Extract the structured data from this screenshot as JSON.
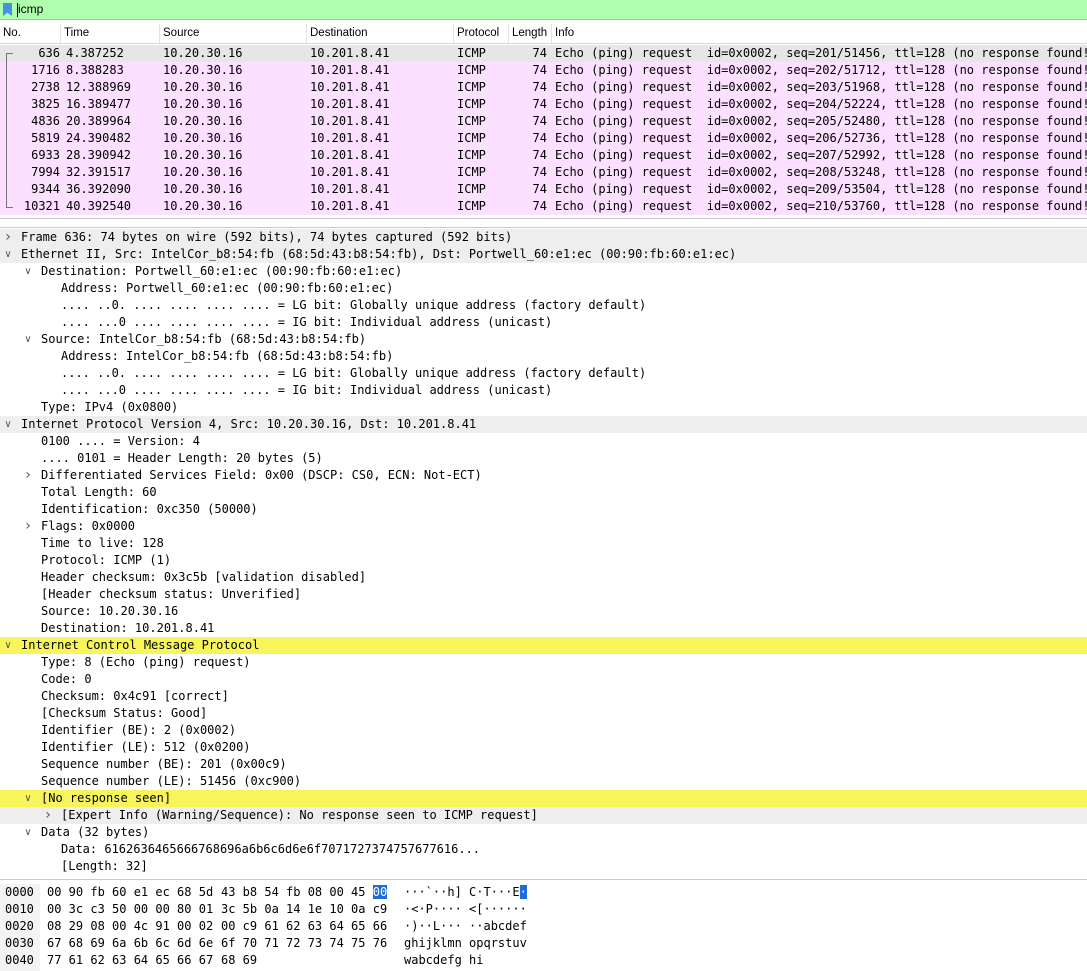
{
  "filter": {
    "value": "icmp"
  },
  "columns": [
    "No.",
    "Time",
    "Source",
    "Destination",
    "Protocol",
    "Length",
    "Info"
  ],
  "packets": [
    {
      "no": "636",
      "time": "4.387252",
      "src": "10.20.30.16",
      "dst": "10.201.8.41",
      "proto": "ICMP",
      "len": "74",
      "info": "Echo (ping) request  id=0x0002, seq=201/51456, ttl=128 (no response found!)"
    },
    {
      "no": "1716",
      "time": "8.388283",
      "src": "10.20.30.16",
      "dst": "10.201.8.41",
      "proto": "ICMP",
      "len": "74",
      "info": "Echo (ping) request  id=0x0002, seq=202/51712, ttl=128 (no response found!)"
    },
    {
      "no": "2738",
      "time": "12.388969",
      "src": "10.20.30.16",
      "dst": "10.201.8.41",
      "proto": "ICMP",
      "len": "74",
      "info": "Echo (ping) request  id=0x0002, seq=203/51968, ttl=128 (no response found!)"
    },
    {
      "no": "3825",
      "time": "16.389477",
      "src": "10.20.30.16",
      "dst": "10.201.8.41",
      "proto": "ICMP",
      "len": "74",
      "info": "Echo (ping) request  id=0x0002, seq=204/52224, ttl=128 (no response found!)"
    },
    {
      "no": "4836",
      "time": "20.389964",
      "src": "10.20.30.16",
      "dst": "10.201.8.41",
      "proto": "ICMP",
      "len": "74",
      "info": "Echo (ping) request  id=0x0002, seq=205/52480, ttl=128 (no response found!)"
    },
    {
      "no": "5819",
      "time": "24.390482",
      "src": "10.20.30.16",
      "dst": "10.201.8.41",
      "proto": "ICMP",
      "len": "74",
      "info": "Echo (ping) request  id=0x0002, seq=206/52736, ttl=128 (no response found!)"
    },
    {
      "no": "6933",
      "time": "28.390942",
      "src": "10.20.30.16",
      "dst": "10.201.8.41",
      "proto": "ICMP",
      "len": "74",
      "info": "Echo (ping) request  id=0x0002, seq=207/52992, ttl=128 (no response found!)"
    },
    {
      "no": "7994",
      "time": "32.391517",
      "src": "10.20.30.16",
      "dst": "10.201.8.41",
      "proto": "ICMP",
      "len": "74",
      "info": "Echo (ping) request  id=0x0002, seq=208/53248, ttl=128 (no response found!)"
    },
    {
      "no": "9344",
      "time": "36.392090",
      "src": "10.20.30.16",
      "dst": "10.201.8.41",
      "proto": "ICMP",
      "len": "74",
      "info": "Echo (ping) request  id=0x0002, seq=209/53504, ttl=128 (no response found!)"
    },
    {
      "no": "10321",
      "time": "40.392540",
      "src": "10.20.30.16",
      "dst": "10.201.8.41",
      "proto": "ICMP",
      "len": "74",
      "info": "Echo (ping) request  id=0x0002, seq=210/53760, ttl=128 (no response found!)"
    }
  ],
  "details": [
    {
      "level": 0,
      "exp": "collapsed",
      "text": "Frame 636: 74 bytes on wire (592 bits), 74 bytes captured (592 bits)",
      "style": "hl"
    },
    {
      "level": 0,
      "exp": "expanded",
      "text": "Ethernet II, Src: IntelCor_b8:54:fb (68:5d:43:b8:54:fb), Dst: Portwell_60:e1:ec (00:90:fb:60:e1:ec)",
      "style": "hl"
    },
    {
      "level": 1,
      "exp": "expanded",
      "text": "Destination: Portwell_60:e1:ec (00:90:fb:60:e1:ec)",
      "style": ""
    },
    {
      "level": 2,
      "exp": "",
      "text": "Address: Portwell_60:e1:ec (00:90:fb:60:e1:ec)",
      "style": ""
    },
    {
      "level": 2,
      "exp": "",
      "text": ".... ..0. .... .... .... .... = LG bit: Globally unique address (factory default)",
      "style": ""
    },
    {
      "level": 2,
      "exp": "",
      "text": ".... ...0 .... .... .... .... = IG bit: Individual address (unicast)",
      "style": ""
    },
    {
      "level": 1,
      "exp": "expanded",
      "text": "Source: IntelCor_b8:54:fb (68:5d:43:b8:54:fb)",
      "style": ""
    },
    {
      "level": 2,
      "exp": "",
      "text": "Address: IntelCor_b8:54:fb (68:5d:43:b8:54:fb)",
      "style": ""
    },
    {
      "level": 2,
      "exp": "",
      "text": ".... ..0. .... .... .... .... = LG bit: Globally unique address (factory default)",
      "style": ""
    },
    {
      "level": 2,
      "exp": "",
      "text": ".... ...0 .... .... .... .... = IG bit: Individual address (unicast)",
      "style": ""
    },
    {
      "level": 1,
      "exp": "",
      "text": "Type: IPv4 (0x0800)",
      "style": ""
    },
    {
      "level": 0,
      "exp": "expanded",
      "text": "Internet Protocol Version 4, Src: 10.20.30.16, Dst: 10.201.8.41",
      "style": "hl"
    },
    {
      "level": 1,
      "exp": "",
      "text": "0100 .... = Version: 4",
      "style": ""
    },
    {
      "level": 1,
      "exp": "",
      "text": ".... 0101 = Header Length: 20 bytes (5)",
      "style": ""
    },
    {
      "level": 1,
      "exp": "collapsed",
      "text": "Differentiated Services Field: 0x00 (DSCP: CS0, ECN: Not-ECT)",
      "style": ""
    },
    {
      "level": 1,
      "exp": "",
      "text": "Total Length: 60",
      "style": ""
    },
    {
      "level": 1,
      "exp": "",
      "text": "Identification: 0xc350 (50000)",
      "style": ""
    },
    {
      "level": 1,
      "exp": "collapsed",
      "text": "Flags: 0x0000",
      "style": ""
    },
    {
      "level": 1,
      "exp": "",
      "text": "Time to live: 128",
      "style": ""
    },
    {
      "level": 1,
      "exp": "",
      "text": "Protocol: ICMP (1)",
      "style": ""
    },
    {
      "level": 1,
      "exp": "",
      "text": "Header checksum: 0x3c5b [validation disabled]",
      "style": ""
    },
    {
      "level": 1,
      "exp": "",
      "text": "[Header checksum status: Unverified]",
      "style": ""
    },
    {
      "level": 1,
      "exp": "",
      "text": "Source: 10.20.30.16",
      "style": ""
    },
    {
      "level": 1,
      "exp": "",
      "text": "Destination: 10.201.8.41",
      "style": ""
    },
    {
      "level": 0,
      "exp": "expanded",
      "text": "Internet Control Message Protocol",
      "style": "yel"
    },
    {
      "level": 1,
      "exp": "",
      "text": "Type: 8 (Echo (ping) request)",
      "style": ""
    },
    {
      "level": 1,
      "exp": "",
      "text": "Code: 0",
      "style": ""
    },
    {
      "level": 1,
      "exp": "",
      "text": "Checksum: 0x4c91 [correct]",
      "style": ""
    },
    {
      "level": 1,
      "exp": "",
      "text": "[Checksum Status: Good]",
      "style": ""
    },
    {
      "level": 1,
      "exp": "",
      "text": "Identifier (BE): 2 (0x0002)",
      "style": ""
    },
    {
      "level": 1,
      "exp": "",
      "text": "Identifier (LE): 512 (0x0200)",
      "style": ""
    },
    {
      "level": 1,
      "exp": "",
      "text": "Sequence number (BE): 201 (0x00c9)",
      "style": ""
    },
    {
      "level": 1,
      "exp": "",
      "text": "Sequence number (LE): 51456 (0xc900)",
      "style": ""
    },
    {
      "level": 1,
      "exp": "expanded",
      "text": "[No response seen]",
      "style": "yel"
    },
    {
      "level": 2,
      "exp": "collapsed",
      "text": "[Expert Info (Warning/Sequence): No response seen to ICMP request]",
      "style": "hl"
    },
    {
      "level": 1,
      "exp": "expanded",
      "text": "Data (32 bytes)",
      "style": ""
    },
    {
      "level": 2,
      "exp": "",
      "text": "Data: 6162636465666768696a6b6c6d6e6f7071727374757677616...",
      "style": ""
    },
    {
      "level": 2,
      "exp": "",
      "text": "[Length: 32]",
      "style": ""
    }
  ],
  "bytes": [
    {
      "off": "0000",
      "hex1": "00 90 fb 60 e1 ec 68 5d",
      "hex2pre": "43 b8 54 fb 08 00 45 ",
      "hex2sel": "00",
      "ascpre": "···`··h] C·T···E",
      "ascsel": "·"
    },
    {
      "off": "0010",
      "hex1": "00 3c c3 50 00 00 80 01",
      "hex2pre": "3c 5b 0a 14 1e 10 0a c9",
      "hex2sel": "",
      "ascpre": "·<·P···· <[······",
      "ascsel": ""
    },
    {
      "off": "0020",
      "hex1": "08 29 08 00 4c 91 00 02",
      "hex2pre": "00 c9 61 62 63 64 65 66",
      "hex2sel": "",
      "ascpre": "·)··L··· ··abcdef",
      "ascsel": ""
    },
    {
      "off": "0030",
      "hex1": "67 68 69 6a 6b 6c 6d 6e",
      "hex2pre": "6f 70 71 72 73 74 75 76",
      "hex2sel": "",
      "ascpre": "ghijklmn opqrstuv",
      "ascsel": ""
    },
    {
      "off": "0040",
      "hex1": "77 61 62 63 64 65 66 67",
      "hex2pre": "68 69",
      "hex2sel": "",
      "ascpre": "wabcdefg hi",
      "ascsel": ""
    }
  ]
}
